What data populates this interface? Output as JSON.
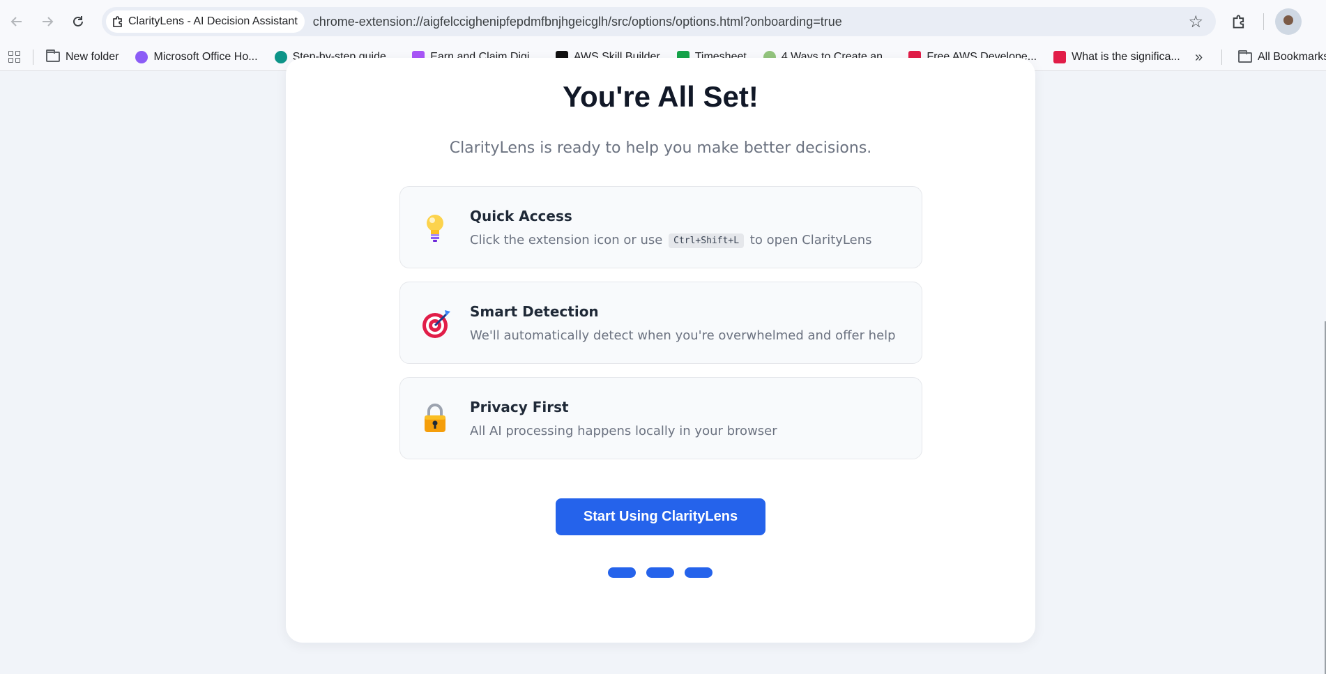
{
  "browser": {
    "tab_title": "ClarityLens - AI Decision Assistant",
    "url": "chrome-extension://aigfelccighenipfepdmfbnjhgeicglh/src/options/options.html?onboarding=true"
  },
  "bookmarks": [
    {
      "label": "New folder",
      "icon": "folder-icon",
      "color": "#5f6368"
    },
    {
      "label": "Microsoft Office Ho...",
      "icon": "copilot-icon",
      "color": "#8b5cf6"
    },
    {
      "label": "Step-by-step guide...",
      "icon": "eye-icon",
      "color": "#0d9488"
    },
    {
      "label": "Earn and Claim Digi...",
      "icon": "cube-icon",
      "color": "#a855f7"
    },
    {
      "label": "AWS Skill Builder",
      "icon": "aws-icon",
      "color": "#111111"
    },
    {
      "label": "Timesheet",
      "icon": "excel-icon",
      "color": "#16a34a"
    },
    {
      "label": "4 Ways to Create an...",
      "icon": "wikihow-icon",
      "color": "#93c47d"
    },
    {
      "label": "Free AWS Develope...",
      "icon": "bookmark-red-icon",
      "color": "#e11d48"
    },
    {
      "label": "What is the significa...",
      "icon": "bookmark-red-icon",
      "color": "#e11d48"
    }
  ],
  "all_bookmarks_label": "All Bookmarks",
  "onboarding": {
    "title": "You're All Set!",
    "subtitle": "ClarityLens is ready to help you make better decisions.",
    "features": [
      {
        "icon": "lightbulb-icon",
        "title": "Quick Access",
        "desc_before": "Click the extension icon or use",
        "shortcut": "Ctrl+Shift+L",
        "desc_after": "to open ClarityLens"
      },
      {
        "icon": "target-icon",
        "title": "Smart Detection",
        "desc": "We'll automatically detect when you're overwhelmed and offer help"
      },
      {
        "icon": "lock-icon",
        "title": "Privacy First",
        "desc": "All AI processing happens locally in your browser"
      }
    ],
    "cta_label": "Start Using ClarityLens",
    "steps_total": 3,
    "accent_color": "#2563eb"
  }
}
